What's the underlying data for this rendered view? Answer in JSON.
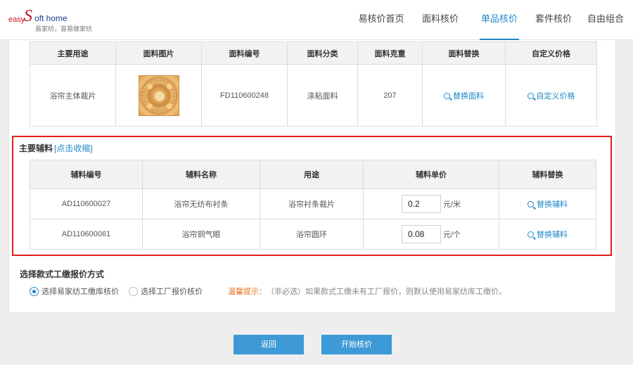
{
  "brand": {
    "logo_easy": "easy",
    "logo_s": "S",
    "logo_oft": "oft home",
    "slogan": "易家纺，容易做家纺"
  },
  "nav": [
    {
      "label": "易核价首页",
      "active": false
    },
    {
      "label": "面料核价",
      "active": false
    },
    {
      "label": "单品核价",
      "active": true
    },
    {
      "label": "套件核价",
      "active": false
    },
    {
      "label": "自由组合",
      "active": false
    }
  ],
  "fabric_table": {
    "headers": [
      "主要用途",
      "面料图片",
      "面料编号",
      "面料分类",
      "面料克重",
      "面料替换",
      "自定义价格"
    ],
    "row": {
      "usage": "浴帘主体裁片",
      "code": "FD110600248",
      "category": "涤粘面料",
      "weight": "207",
      "replace_label": "替换面料",
      "custom_price_label": "自定义价格"
    }
  },
  "accessories": {
    "title": "主要辅料",
    "toggle_label": "[点击收缩]",
    "headers": [
      "辅料编号",
      "辅料名称",
      "用途",
      "辅料单价",
      "辅料替换"
    ],
    "rows": [
      {
        "code": "AD110600027",
        "name": "浴帘无纺布衬条",
        "usage": "浴帘衬条裁片",
        "price": "0.2",
        "unit": "元/米",
        "replace_label": "替换辅料"
      },
      {
        "code": "AD110600061",
        "name": "浴帘铜气眼",
        "usage": "浴帘圆环",
        "price": "0.08",
        "unit": "元/个",
        "replace_label": "替换辅料"
      }
    ]
  },
  "quote_method": {
    "title": "选择款式工缴报价方式",
    "options": [
      {
        "label": "选择易家纺工缴库核价",
        "selected": true
      },
      {
        "label": "选择工厂报价核价",
        "selected": false
      }
    ],
    "tip_label": "温馨提示：",
    "tip_text": "（非必选）如果款式工缴未有工厂报价，则默认使用易家纺库工缴价。"
  },
  "buttons": {
    "back": "返回",
    "start": "开始核价"
  },
  "colors": {
    "accent": "#1f87c7",
    "highlight_border": "#e01e1e",
    "tip": "#e8711d",
    "button": "#3d9ad6"
  }
}
